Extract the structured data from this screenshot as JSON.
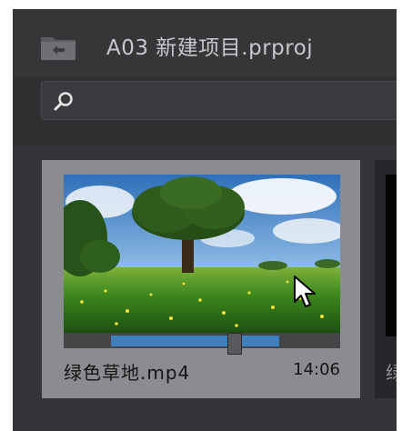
{
  "project": {
    "title": "A03 新建项目.prproj"
  },
  "search": {
    "value": "",
    "placeholder": ""
  },
  "clips": [
    {
      "name": "绿色草地.mp4",
      "duration": "14:06",
      "playhead": 0.62,
      "range_in": 0.17,
      "range_out": 0.78
    },
    {
      "name": "绿"
    }
  ],
  "icons": {
    "folder": "folder-up-icon",
    "search": "search-icon",
    "cursor": "mouse-pointer-icon"
  },
  "colors": {
    "panel_bg": "#2f3032",
    "card_bg": "#8a8c90",
    "scrub_fill": "#3f7fbd"
  }
}
